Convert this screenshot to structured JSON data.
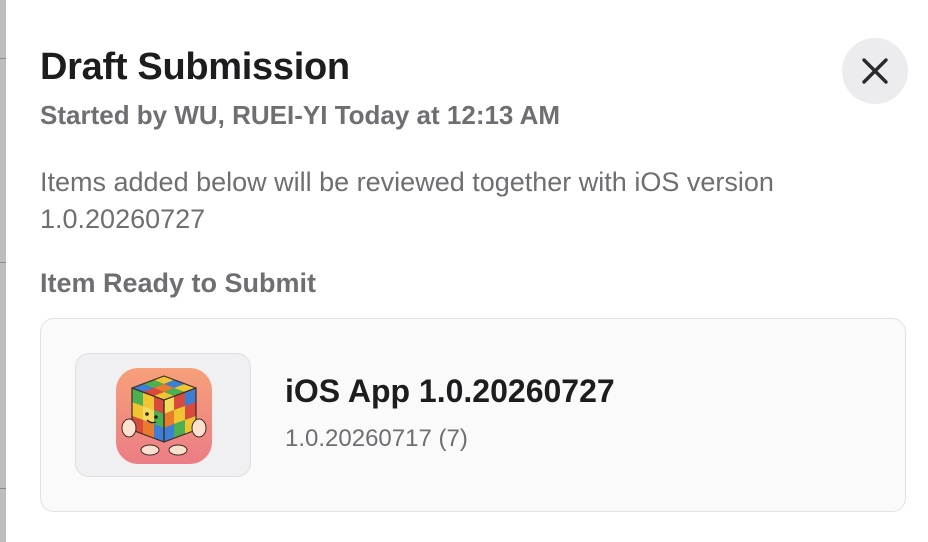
{
  "dialog": {
    "title": "Draft Submission",
    "subtitle": "Started by WU, RUEI-YI Today at 12:13 AM",
    "close_icon": "close-icon",
    "description": "Items added below will be reviewed together with iOS version 1.0.20260727",
    "section_heading": "Item Ready to Submit"
  },
  "item": {
    "title": "iOS App 1.0.20260727",
    "build": "1.0.20260717 (7)",
    "icon": "rubiks-cube-app-icon"
  },
  "colors": {
    "title_text": "#1d1d1f",
    "secondary_text": "#6e6e73",
    "close_button_bg": "#ececee",
    "card_bg": "#fafafa",
    "card_border": "#e2e2e5"
  }
}
